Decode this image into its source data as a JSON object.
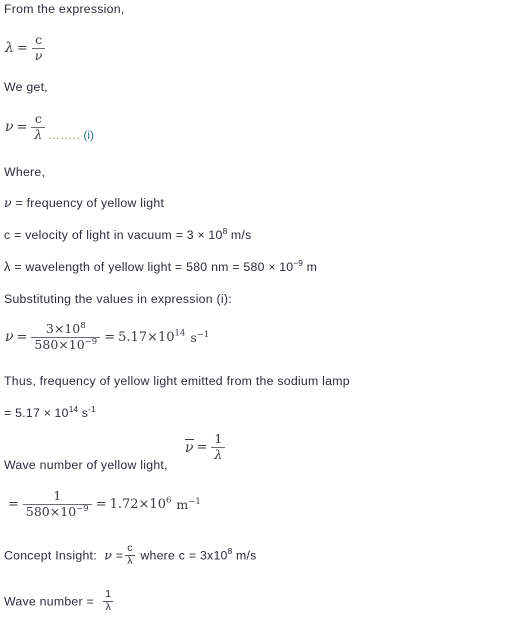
{
  "document": {
    "type": "physics-solution",
    "topic": "frequency and wave number of yellow sodium light",
    "background_color": "#ffffff",
    "text_color": "#2b2b3a"
  },
  "lines": {
    "intro": "From the expression,",
    "we_get": "We get,",
    "where": "Where,",
    "freq_def_rest": " = frequency of yellow light",
    "velocity_def": "c = velocity of light in vacuum = 3 ",
    "velocity_times": "×",
    "velocity_base": " 10",
    "velocity_exp": "8",
    "velocity_unit": " m/s",
    "wavelength_def": " = wavelength of yellow light = 580 nm = 580 ",
    "wavelength_times": "×",
    "wavelength_base": " 10",
    "wavelength_exp": "−9",
    "wavelength_unit": " m",
    "substituting": "Substituting the values in expression (i):",
    "thus": "Thus, frequency of yellow light emitted from the sodium lamp",
    "result_prefix": "= 5.17 ",
    "result_times": "×",
    "result_base": " 10",
    "result_exp": "14",
    "result_unit_s": "s",
    "result_unit_s_exp": "-1",
    "wave_number_label": "Wave number of yellow light,",
    "concept_insight_label": "Concept Insight:",
    "concept_where": "where c",
    "concept_equals": "=",
    "concept_value": "3x10",
    "concept_exp": "8",
    "concept_unit": "m/s",
    "wave_number_final_label": "Wave number ="
  },
  "symbols": {
    "lambda": "λ",
    "nu": "ν",
    "c": "c",
    "equals": "=",
    "one": "1",
    "dots": "……..",
    "eq_number": "(i)"
  },
  "equations": {
    "lambda_eq_c_over_nu": {
      "lhs": "λ",
      "op": "=",
      "numerator": "c",
      "denominator": "ν"
    },
    "nu_eq_c_over_lambda": {
      "lhs": "ν",
      "op": "=",
      "numerator": "c",
      "denominator": "λ",
      "dots": "……..",
      "eq_number": "(i)"
    },
    "frequency_calc": {
      "lhs": "ν",
      "op1": "=",
      "num_base": "3×10",
      "num_exp": "8",
      "den_base": "580×10",
      "den_exp": "−9",
      "op2": "=",
      "result_base": "5.17×10",
      "result_exp": "14",
      "unit": "s",
      "unit_exp": "−1"
    },
    "wave_number_def": {
      "lhs": "ν",
      "has_overbar": true,
      "op": "=",
      "numerator": "1",
      "denominator": "λ"
    },
    "wave_number_calc": {
      "op1": "=",
      "numerator": "1",
      "den_base": "580×10",
      "den_exp": "−9",
      "op2": "=",
      "result_base": "1.72×10",
      "result_exp": "6",
      "unit": "m",
      "unit_exp": "−1"
    },
    "concept_insight_formula": {
      "lhs": "ν",
      "op": "=",
      "numerator": "c",
      "denominator": "λ"
    },
    "wave_number_final": {
      "numerator": "1",
      "denominator": "λ"
    }
  }
}
